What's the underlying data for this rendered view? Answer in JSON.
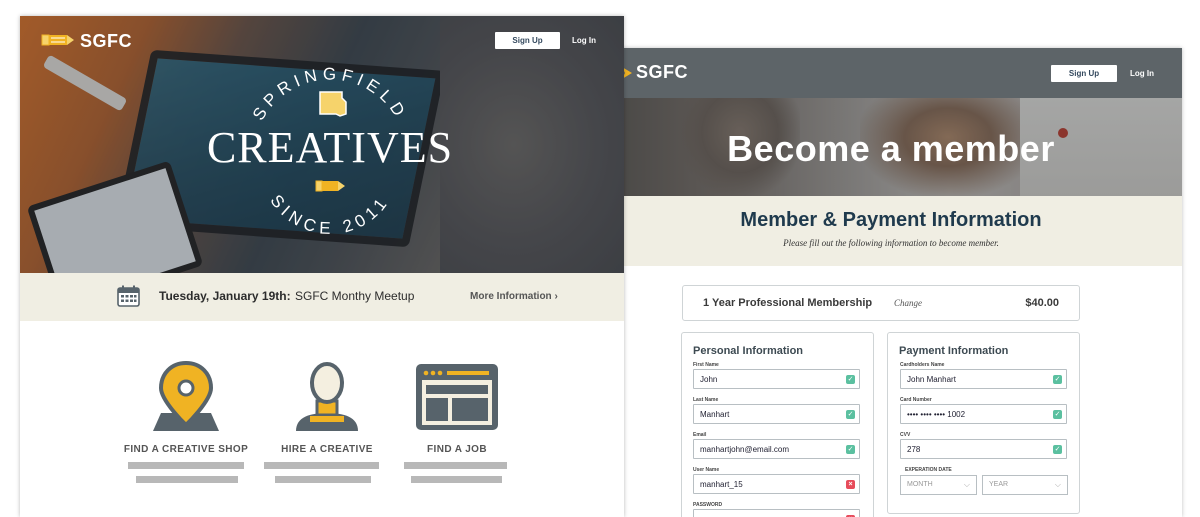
{
  "colors": {
    "nav_dark": "#5d6468",
    "band": "#f0eee3",
    "navy": "#1f3a4d",
    "gold": "#f0b323",
    "slate": "#57636b",
    "valid": "#5bc0a0",
    "invalid": "#e74c5b"
  },
  "left": {
    "nav": {
      "logo_icon": "pencil-icon",
      "logo": "SGFC",
      "signup": "Sign Up",
      "login": "Log In"
    },
    "hero": {
      "arc_top": "SPRINGFIELD",
      "title": "CREATIVES",
      "arc_bottom": "SINCE 2011",
      "state_icon": "missouri-state-icon"
    },
    "event": {
      "icon": "calendar-icon",
      "date": "Tuesday, January 19th:",
      "name": "SGFC Monthy Meetup",
      "link": "More Information ›"
    },
    "features": [
      {
        "icon": "location-pin-icon",
        "label": "FIND A CREATIVE SHOP"
      },
      {
        "icon": "person-bust-icon",
        "label": "HIRE A CREATIVE"
      },
      {
        "icon": "browser-window-icon",
        "label": "FIND A JOB"
      }
    ]
  },
  "right": {
    "nav": {
      "logo": "SGFC",
      "signup": "Sign Up",
      "login": "Log In"
    },
    "hero_title": "Become a member",
    "section_title": "Member & Payment Information",
    "section_subtitle": "Please fill out the following information to become member.",
    "plan": {
      "name": "1 Year Professional Membership",
      "change": "Change",
      "price": "$40.00"
    },
    "personal": {
      "title": "Personal Information",
      "fields": [
        {
          "label": "First Name",
          "value": "John",
          "status": "valid"
        },
        {
          "label": "Last Name",
          "value": "Manhart",
          "status": "valid"
        },
        {
          "label": "Email",
          "value": "manhartjohn@email.com",
          "status": "valid"
        },
        {
          "label": "User Name",
          "value": "manhart_15",
          "status": "invalid"
        },
        {
          "label": "PASSWORD",
          "value": "",
          "status": "invalid"
        }
      ]
    },
    "payment": {
      "title": "Payment Information",
      "fields": [
        {
          "label": "Cardholders Name",
          "value": "John Manhart",
          "status": "valid"
        },
        {
          "label": "Card Number",
          "value": "•••• •••• •••• 1002",
          "status": "valid"
        },
        {
          "label": "CVV",
          "value": "278",
          "status": "valid"
        }
      ],
      "expiration_label": "EXPERATION DATE",
      "month_placeholder": "MONTH",
      "year_placeholder": "YEAR"
    }
  }
}
